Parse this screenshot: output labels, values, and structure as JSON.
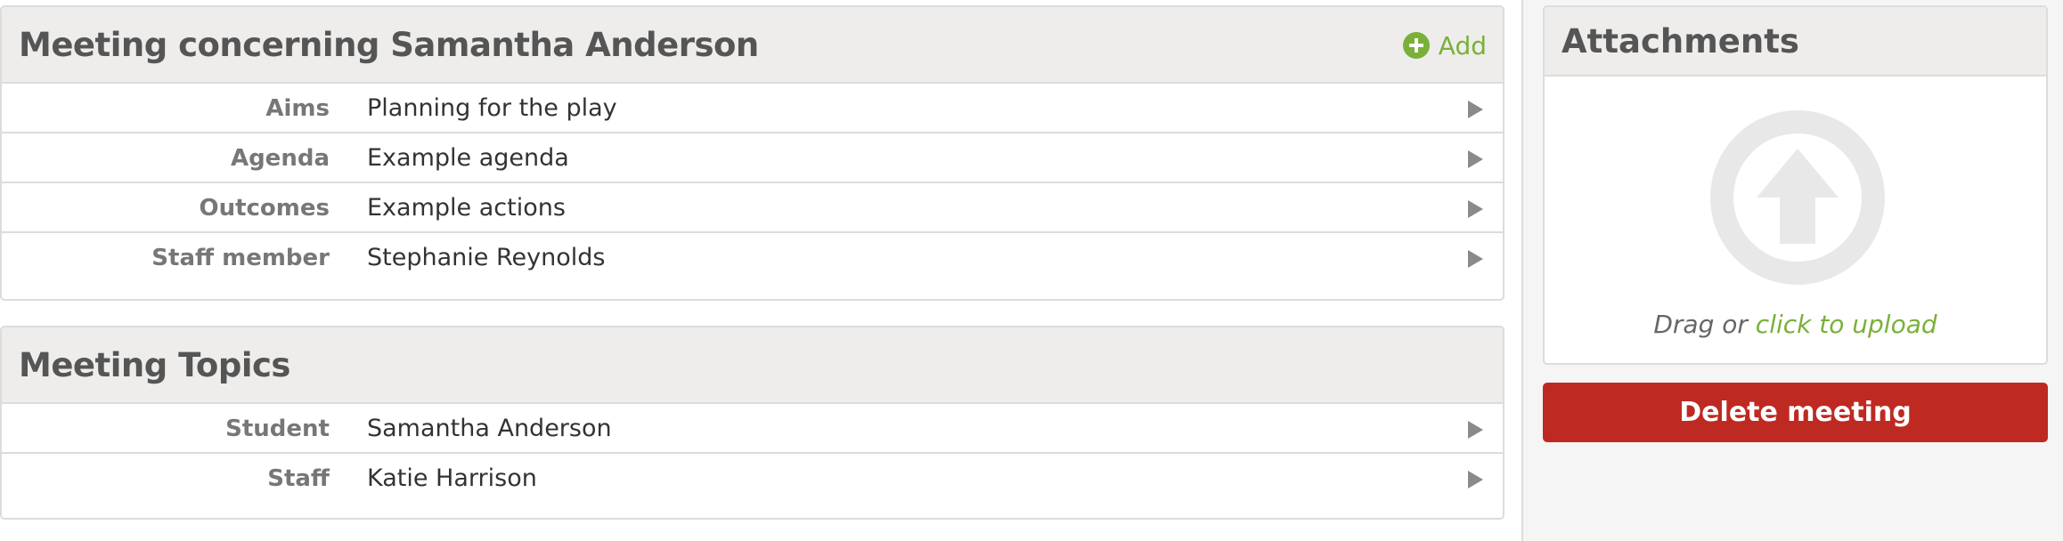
{
  "meeting_panel": {
    "title": "Meeting concerning Samantha Anderson",
    "add_label": "Add",
    "rows": [
      {
        "label": "Aims",
        "value": "Planning for the play"
      },
      {
        "label": "Agenda",
        "value": "Example agenda"
      },
      {
        "label": "Outcomes",
        "value": "Example actions"
      },
      {
        "label": "Staff member",
        "value": "Stephanie Reynolds"
      }
    ]
  },
  "topics_panel": {
    "title": "Meeting Topics",
    "rows": [
      {
        "label": "Student",
        "value": "Samantha Anderson"
      },
      {
        "label": "Staff",
        "value": "Katie Harrison"
      }
    ]
  },
  "attachments": {
    "title": "Attachments",
    "drag_text": "Drag or ",
    "upload_link": "click to upload",
    "icon": "upload-arrow-icon"
  },
  "delete_button": "Delete meeting",
  "colors": {
    "accent_green": "#7ab03a",
    "danger_red": "#be2a22",
    "header_bg": "#eeedeb",
    "border": "#dcdcdc"
  }
}
